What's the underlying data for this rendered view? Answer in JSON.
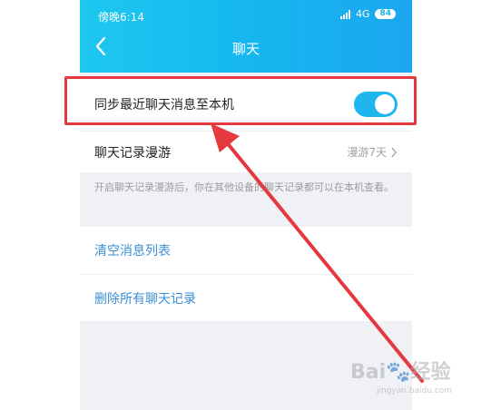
{
  "status": {
    "time": "傍晚6:14",
    "network": "4G",
    "battery": "84"
  },
  "header": {
    "title": "聊天"
  },
  "settings": {
    "sync_label": "同步最近聊天消息至本机",
    "sync_enabled": true,
    "roaming_label": "聊天记录漫游",
    "roaming_value": "漫游7天",
    "roaming_note": "开启聊天记录漫游后，你在其他设备的聊天记录都可以在本机查看。",
    "clear_list": "清空消息列表",
    "delete_all": "删除所有聊天记录"
  },
  "watermark": {
    "text": "Bai🐾经验",
    "sub": "jingyan.baidu.com"
  },
  "colors": {
    "accent": "#1fb6ef",
    "highlight": "#e6393f",
    "link": "#3b8ed8"
  }
}
